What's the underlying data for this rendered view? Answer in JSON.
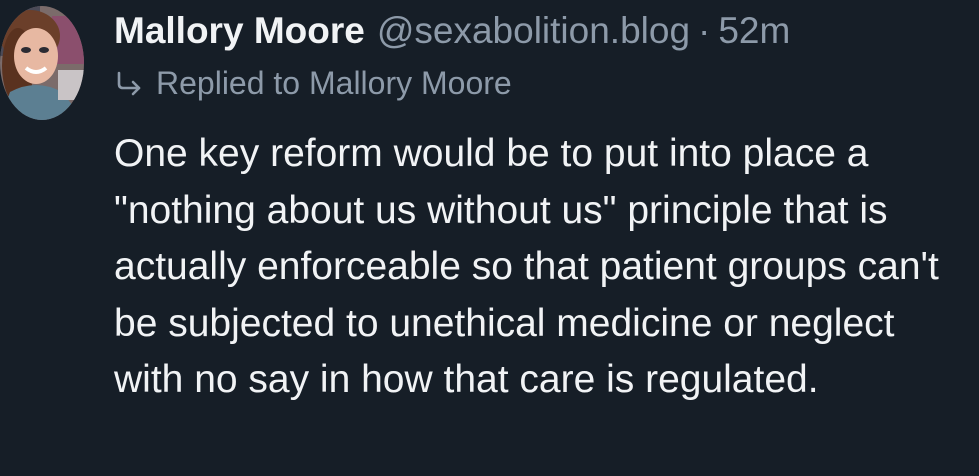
{
  "post": {
    "author": {
      "display_name": "Mallory Moore",
      "handle": "@sexabolition.blog",
      "avatar_icon": "user-avatar-photo"
    },
    "separator": "·",
    "timestamp": "52m",
    "reply": {
      "icon": "reply-arrow-icon",
      "prefix": "Replied to",
      "target": "Mallory Moore"
    },
    "text": "One key reform would be to put into place a \"nothing about us without us\" principle that is actually enforceable so that patient groups can't be subjected to unethical medicine or neglect with no say in how that care is regulated."
  },
  "colors": {
    "background": "#161e27",
    "primary_text": "#f1f3f5",
    "secondary_text": "#8d9aa9"
  }
}
